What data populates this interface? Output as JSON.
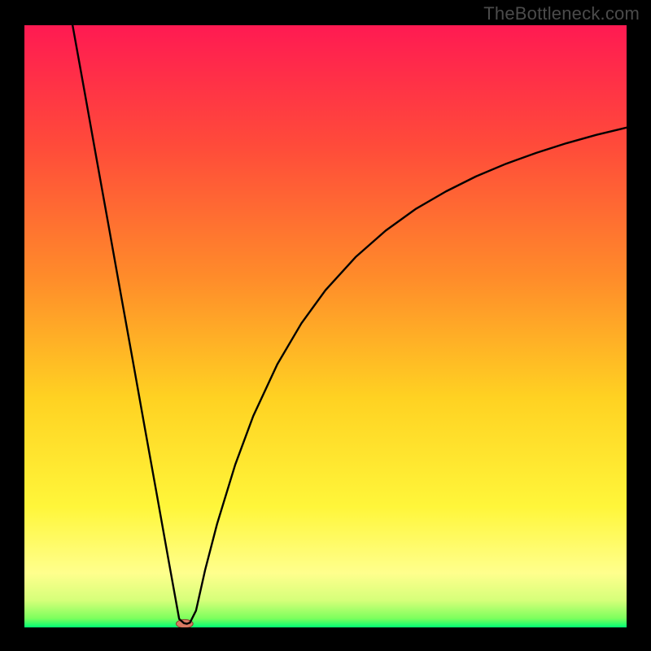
{
  "watermark": "TheBottleneck.com",
  "chart_data": {
    "type": "line",
    "title": "",
    "xlabel": "",
    "ylabel": "",
    "xlim": [
      0,
      100
    ],
    "ylim": [
      0,
      100
    ],
    "grid": false,
    "legend": false,
    "background_gradient_stops": [
      {
        "offset": 0.0,
        "color": "#ff1a52"
      },
      {
        "offset": 0.2,
        "color": "#ff4b3a"
      },
      {
        "offset": 0.42,
        "color": "#ff8c2a"
      },
      {
        "offset": 0.62,
        "color": "#ffd222"
      },
      {
        "offset": 0.8,
        "color": "#fff63a"
      },
      {
        "offset": 0.91,
        "color": "#ffff8d"
      },
      {
        "offset": 0.955,
        "color": "#d6ff7a"
      },
      {
        "offset": 0.985,
        "color": "#7dff5d"
      },
      {
        "offset": 1.0,
        "color": "#00ff74"
      }
    ],
    "series": [
      {
        "name": "curve",
        "color": "#000000",
        "stroke_width": 2.4,
        "x": [
          8,
          10,
          12,
          14,
          16,
          18,
          20,
          22,
          24,
          25.7,
          26.5,
          27,
          27.5,
          28.5,
          30,
          32,
          35,
          38,
          42,
          46,
          50,
          55,
          60,
          65,
          70,
          75,
          80,
          85,
          90,
          95,
          100
        ],
        "y": [
          100,
          88.9,
          77.7,
          66.6,
          55.4,
          44.3,
          33.1,
          22.0,
          10.8,
          1.4,
          0.7,
          0.6,
          0.8,
          2.8,
          9.5,
          17.2,
          27.0,
          35.1,
          43.7,
          50.5,
          56.0,
          61.5,
          65.9,
          69.5,
          72.4,
          74.9,
          77.0,
          78.8,
          80.4,
          81.8,
          83.0
        ]
      }
    ],
    "marker": {
      "name": "highlight-pill",
      "cx": 26.6,
      "cy": 0.6,
      "rx": 1.4,
      "ry": 0.7,
      "fill": "#d97a63",
      "stroke": "#8a3f2c"
    }
  }
}
